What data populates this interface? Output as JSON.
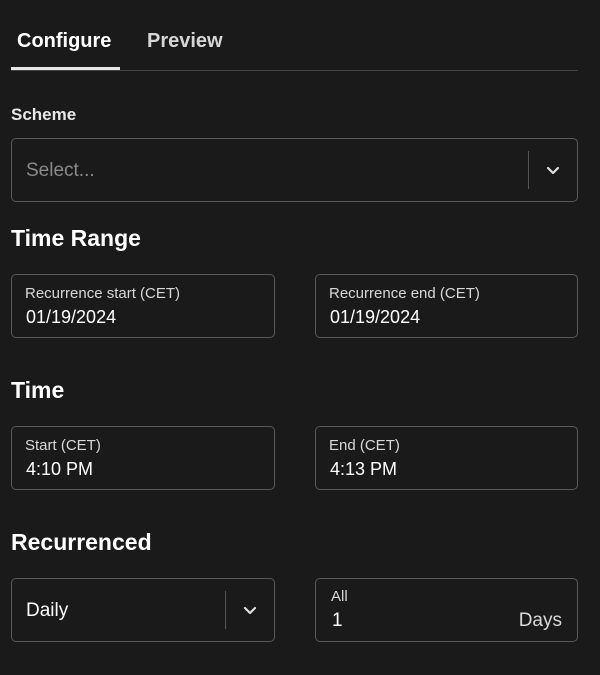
{
  "tabs": {
    "configure": "Configure",
    "preview": "Preview"
  },
  "scheme": {
    "label": "Scheme",
    "placeholder": "Select..."
  },
  "time_range": {
    "title": "Time Range",
    "start_label": "Recurrence start (CET)",
    "start_value": "01/19/2024",
    "end_label": "Recurrence end (CET)",
    "end_value": "01/19/2024"
  },
  "time": {
    "title": "Time",
    "start_label": "Start (CET)",
    "start_value": "4:10 PM",
    "end_label": "End (CET)",
    "end_value": "4:13 PM"
  },
  "recurrence": {
    "title": "Recurrenced",
    "frequency_value": "Daily",
    "interval_label": "All",
    "interval_value": "1",
    "interval_unit": "Days"
  },
  "colors": {
    "background": "#1a1a1a",
    "border": "#5a5a5a",
    "active_tab_underline": "#e6e6e6"
  },
  "icons": {
    "dropdown": "chevron-down-icon"
  }
}
